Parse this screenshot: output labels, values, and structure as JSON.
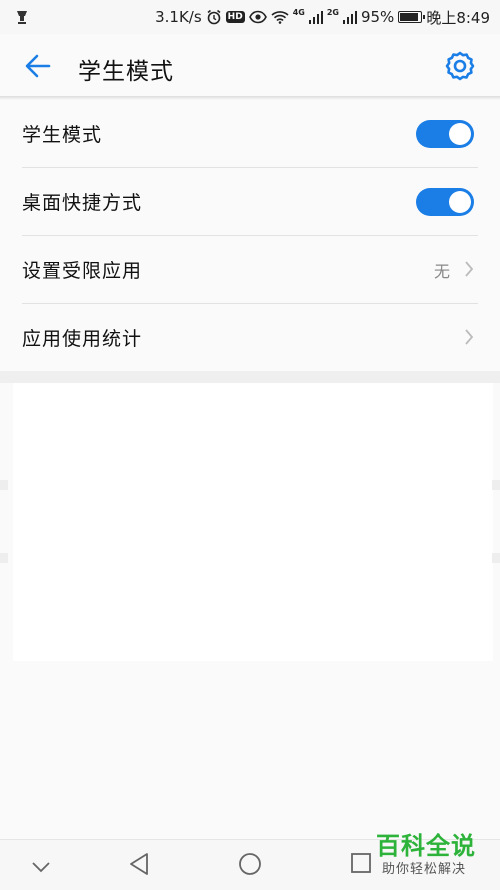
{
  "status_bar": {
    "speed": "3.1K/s",
    "hd_badge": "HD",
    "net1": "4G",
    "net2": "2G",
    "battery_text": "95%",
    "battery_level": 0.95,
    "time": "晚上8:49"
  },
  "header": {
    "title": "学生模式"
  },
  "settings": {
    "student_mode": {
      "label": "学生模式",
      "enabled": true
    },
    "desktop_shortcut": {
      "label": "桌面快捷方式",
      "enabled": true
    },
    "restricted_apps": {
      "label": "设置受限应用",
      "value": "无"
    },
    "usage_stats": {
      "label": "应用使用统计"
    }
  },
  "watermark": {
    "title": "百科全说",
    "subtitle": "助你轻松解决"
  },
  "colors": {
    "accent": "#1b7ee6",
    "watermark_green": "#2db33a"
  }
}
